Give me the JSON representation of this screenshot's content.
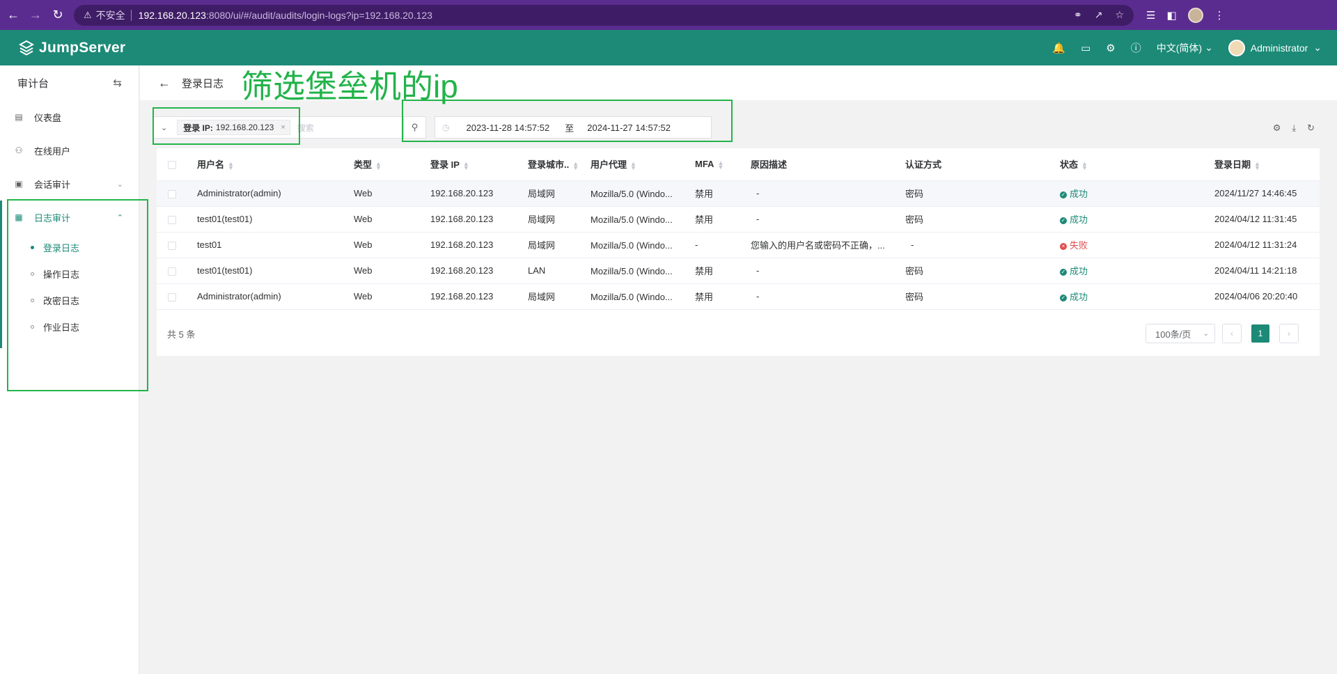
{
  "browser": {
    "warning_label": "不安全",
    "url_host": "192.168.20.123",
    "url_path": ":8080/ui/#/audit/audits/login-logs?ip=192.168.20.123"
  },
  "header": {
    "logo_text": "JumpServer",
    "language": "中文(简体)",
    "user": "Administrator"
  },
  "sidebar": {
    "title": "审计台",
    "items": [
      {
        "label": "仪表盘"
      },
      {
        "label": "在线用户"
      },
      {
        "label": "会话审计"
      },
      {
        "label": "日志审计"
      }
    ],
    "subitems": [
      {
        "label": "登录日志"
      },
      {
        "label": "操作日志"
      },
      {
        "label": "改密日志"
      },
      {
        "label": "作业日志"
      }
    ]
  },
  "page": {
    "title": "登录日志",
    "annotation": "筛选堡垒机的ip"
  },
  "filter": {
    "tag_key": "登录 IP:",
    "tag_value": "192.168.20.123",
    "search_placeholder": "搜索",
    "date_start": "2023-11-28 14:57:52",
    "date_sep": "至",
    "date_end": "2024-11-27 14:57:52"
  },
  "table": {
    "columns": [
      "用户名",
      "类型",
      "登录 IP",
      "登录城市..",
      "用户代理",
      "MFA",
      "原因描述",
      "认证方式",
      "状态",
      "登录日期"
    ],
    "rows": [
      {
        "user": "Administrator(admin)",
        "type": "Web",
        "ip": "192.168.20.123",
        "city": "局域网",
        "agent": "Mozilla/5.0 (Windo...",
        "mfa": "禁用",
        "reason": "-",
        "auth": "密码",
        "status": "成功",
        "status_kind": "ok",
        "date": "2024/11/27 14:46:45"
      },
      {
        "user": "test01(test01)",
        "type": "Web",
        "ip": "192.168.20.123",
        "city": "局域网",
        "agent": "Mozilla/5.0 (Windo...",
        "mfa": "禁用",
        "reason": "-",
        "auth": "密码",
        "status": "成功",
        "status_kind": "ok",
        "date": "2024/04/12 11:31:45"
      },
      {
        "user": "test01",
        "type": "Web",
        "ip": "192.168.20.123",
        "city": "局域网",
        "agent": "Mozilla/5.0 (Windo...",
        "mfa": "-",
        "reason": "您输入的用户名或密码不正确，...",
        "auth": "-",
        "status": "失败",
        "status_kind": "fail",
        "date": "2024/04/12 11:31:24"
      },
      {
        "user": "test01(test01)",
        "type": "Web",
        "ip": "192.168.20.123",
        "city": "LAN",
        "agent": "Mozilla/5.0 (Windo...",
        "mfa": "禁用",
        "reason": "-",
        "auth": "密码",
        "status": "成功",
        "status_kind": "ok",
        "date": "2024/04/11 14:21:18"
      },
      {
        "user": "Administrator(admin)",
        "type": "Web",
        "ip": "192.168.20.123",
        "city": "局域网",
        "agent": "Mozilla/5.0 (Windo...",
        "mfa": "禁用",
        "reason": "-",
        "auth": "密码",
        "status": "成功",
        "status_kind": "ok",
        "date": "2024/04/06 20:20:40"
      }
    ]
  },
  "pagination": {
    "total": "共 5 条",
    "page_size": "100条/页",
    "current_page": "1"
  },
  "colors": {
    "brand": "#1c8a77",
    "browser": "#5b2c8f",
    "annotation": "#22b34a",
    "fail": "#e24e4e"
  }
}
